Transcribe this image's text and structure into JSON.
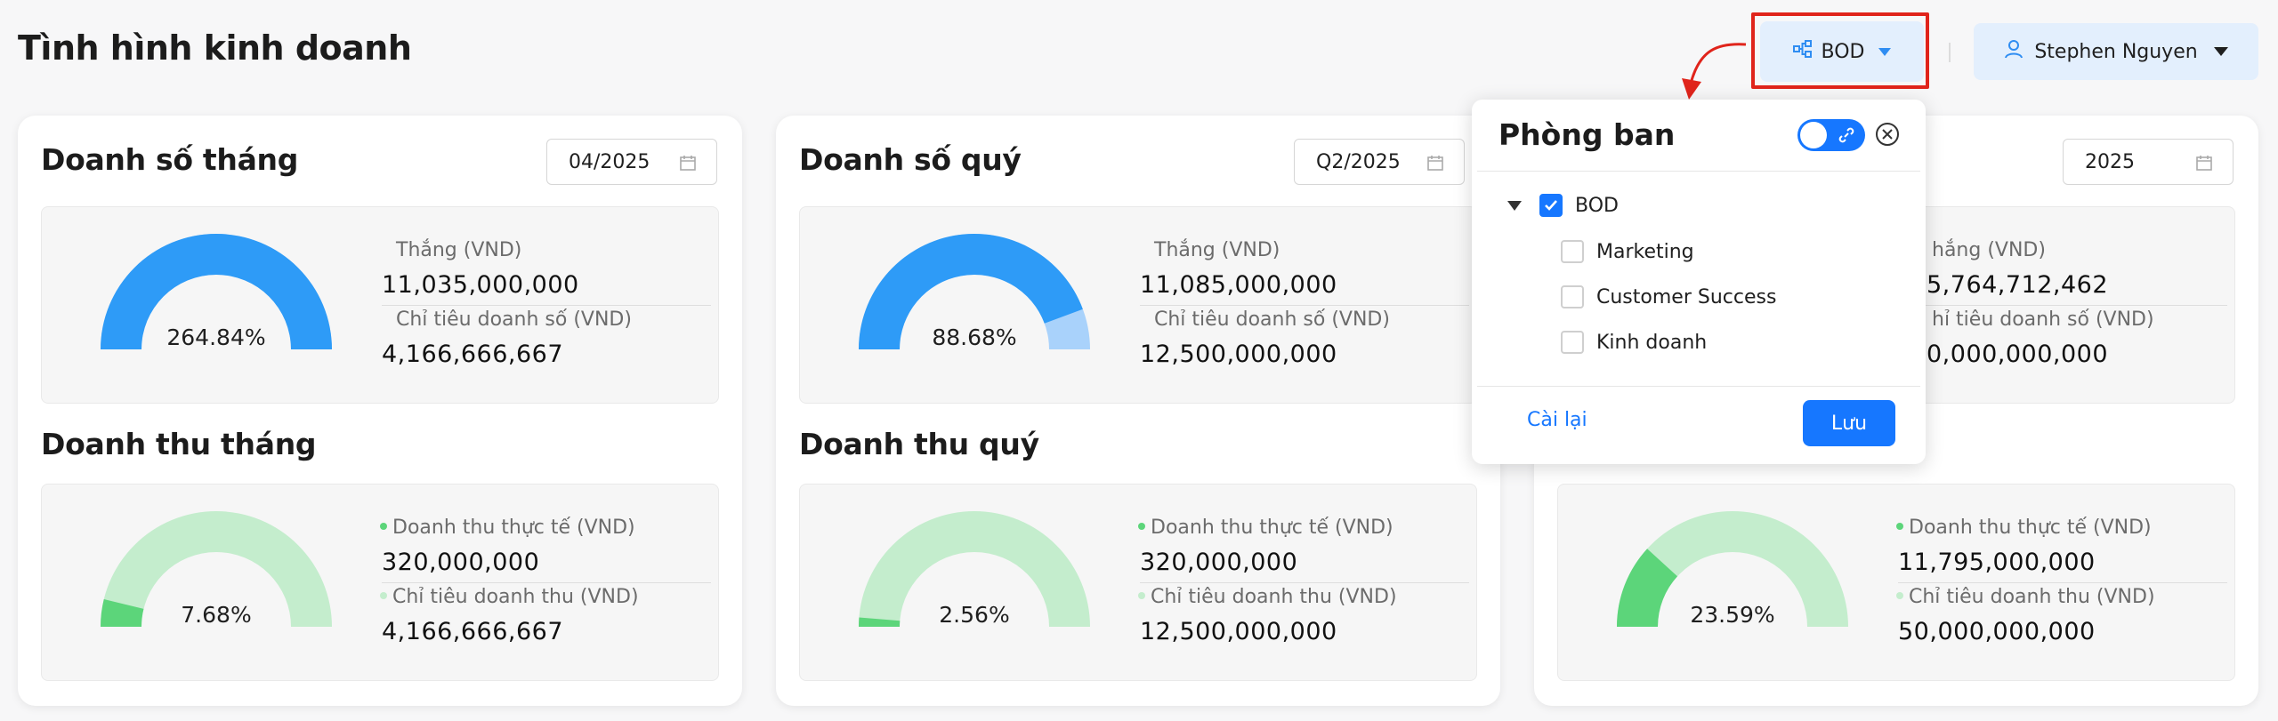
{
  "header": {
    "title": "Tình hình kinh doanh",
    "dept_button": "BOD",
    "user_button": "Stephen Nguyen"
  },
  "colors": {
    "accent": "#1677ff",
    "sales_fill": "#2e9bf7",
    "sales_track": "#a9d2fb",
    "revenue_fill": "#5cd57a",
    "revenue_track": "#c4edcd",
    "highlight": "#e0241b"
  },
  "cards": [
    {
      "sales_title": "Doanh số tháng",
      "period": "04/2025",
      "sales": {
        "percent": "264.84%",
        "ratio": 1.0,
        "won_label": "Thắng (VND)",
        "won_value": "11,035,000,000",
        "target_label": "Chỉ tiêu doanh số (VND)",
        "target_value": "4,166,666,667"
      },
      "revenue_title": "Doanh thu tháng",
      "revenue": {
        "percent": "7.68%",
        "ratio": 0.0768,
        "actual_label": "Doanh thu thực tế (VND)",
        "actual_value": "320,000,000",
        "target_label": "Chỉ tiêu doanh thu (VND)",
        "target_value": "4,166,666,667"
      }
    },
    {
      "sales_title": "Doanh số quý",
      "period": "Q2/2025",
      "sales": {
        "percent": "88.68%",
        "ratio": 0.8868,
        "won_label": "Thắng (VND)",
        "won_value": "11,085,000,000",
        "target_label": "Chỉ tiêu doanh số (VND)",
        "target_value": "12,500,000,000"
      },
      "revenue_title": "Doanh thu quý",
      "revenue": {
        "percent": "2.56%",
        "ratio": 0.0256,
        "actual_label": "Doanh thu thực tế (VND)",
        "actual_value": "320,000,000",
        "target_label": "Chỉ tiêu doanh thu (VND)",
        "target_value": "12,500,000,000"
      }
    },
    {
      "sales_title": "",
      "period": "2025",
      "sales": {
        "percent": "",
        "ratio": 0,
        "won_label": "hắng (VND)",
        "won_value": "5,764,712,462",
        "target_label": "hỉ tiêu doanh số (VND)",
        "target_value": "0,000,000,000"
      },
      "revenue_title": "",
      "revenue": {
        "percent": "23.59%",
        "ratio": 0.2359,
        "actual_label": "Doanh thu thực tế (VND)",
        "actual_value": "11,795,000,000",
        "target_label": "Chỉ tiêu doanh thu (VND)",
        "target_value": "50,000,000,000"
      }
    }
  ],
  "popover": {
    "title": "Phòng ban",
    "tree": [
      {
        "label": "BOD",
        "checked": true
      },
      {
        "label": "Marketing",
        "checked": false
      },
      {
        "label": "Customer Success",
        "checked": false
      },
      {
        "label": "Kinh doanh",
        "checked": false
      }
    ],
    "reset_label": "Cài lại",
    "save_label": "Lưu"
  }
}
